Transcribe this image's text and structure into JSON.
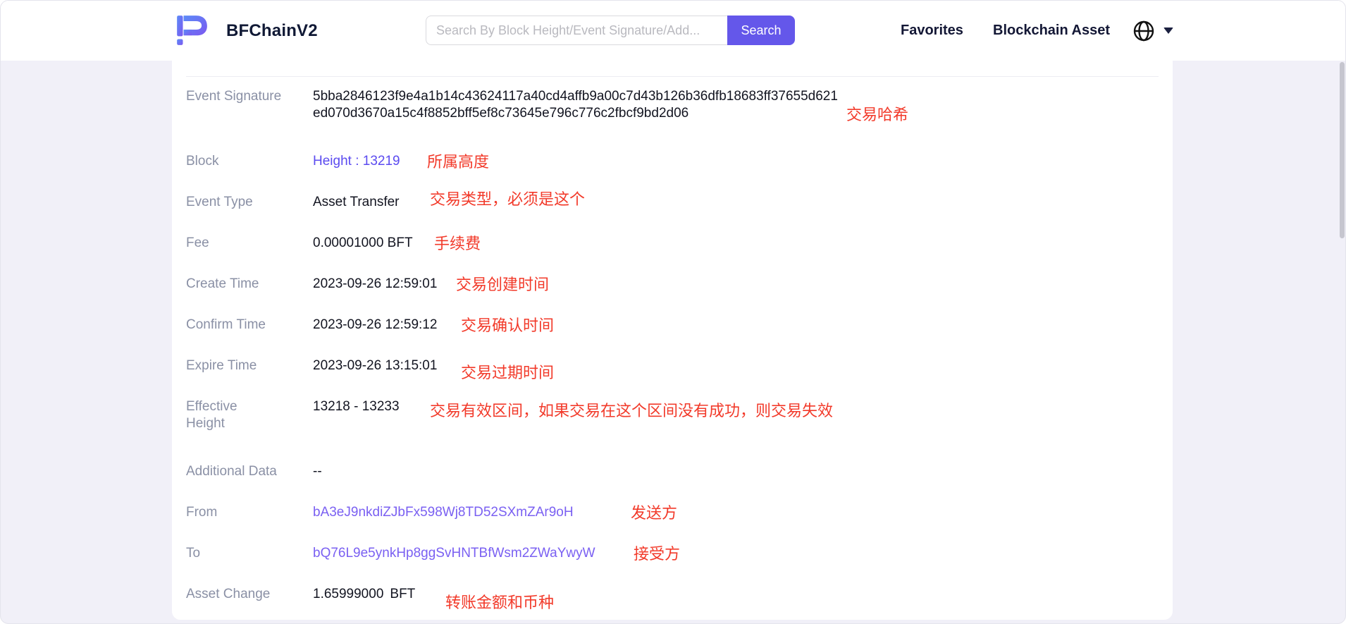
{
  "brand": {
    "name": "BFChainV2",
    "logo_icon": "bfchain-logo"
  },
  "header": {
    "search": {
      "placeholder": "Search By Block Height/Event Signature/Add...",
      "button_label": "Search"
    },
    "nav": {
      "favorites_label": "Favorites",
      "blockchain_asset_label": "Blockchain Asset"
    },
    "language_switcher": {
      "icon": "globe-icon",
      "caret": "chevron-down-icon"
    }
  },
  "colors": {
    "accent_purple": "#6457ea",
    "link_purple": "#5b4bf0",
    "address_purple": "#7a60f2",
    "annotation_red": "#f23a2a",
    "page_background": "#f1f0f8",
    "label_gray": "#8a90a5"
  },
  "detail": {
    "event_signature": {
      "label": "Event Signature",
      "value": "5bba2846123f9e4a1b14c43624117a40cd4affb9a00c7d43b126b36dfb18683ff37655d621ed070d3670a15c4f8852bff5ef8c73645e796c776c2fbcf9bd2d06",
      "note": "交易哈希"
    },
    "block": {
      "label": "Block",
      "value": "Height : 13219",
      "note": "所属高度"
    },
    "event_type": {
      "label": "Event Type",
      "value": "Asset Transfer",
      "note": "交易类型，必须是这个"
    },
    "fee": {
      "label": "Fee",
      "value": "0.00001000 BFT",
      "note": "手续费"
    },
    "create_time": {
      "label": "Create Time",
      "value": "2023-09-26 12:59:01",
      "note": "交易创建时间"
    },
    "confirm_time": {
      "label": "Confirm Time",
      "value": "2023-09-26 12:59:12",
      "note": "交易确认时间"
    },
    "expire_time": {
      "label": "Expire Time",
      "value": "2023-09-26 13:15:01",
      "note": "交易过期时间"
    },
    "effective_height": {
      "label": "Effective Height",
      "value": "13218 - 13233",
      "note": "交易有效区间，如果交易在这个区间没有成功，则交易失效"
    },
    "additional_data": {
      "label": "Additional Data",
      "value": "--"
    },
    "from": {
      "label": "From",
      "value": "bA3eJ9nkdiZJbFx598Wj8TD52SXmZAr9oH",
      "note": "发送方"
    },
    "to": {
      "label": "To",
      "value": "bQ76L9e5ynkHp8ggSvHNTBfWsm2ZWaYwyW",
      "note": "接受方"
    },
    "asset_change": {
      "label": "Asset Change",
      "value": "1.65999000",
      "unit": "BFT",
      "note": "转账金额和币种"
    }
  }
}
